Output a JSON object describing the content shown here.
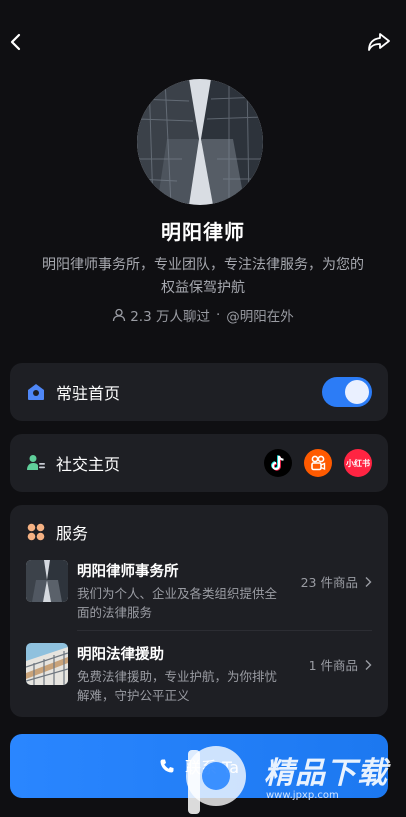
{
  "profile": {
    "name": "明阳律师",
    "description": "明阳律师事务所，专业团队，专注法律服务，为您的权益保驾护航",
    "chat_count": "2.3 万人聊过",
    "separator": "·",
    "handle": "@明阳在外"
  },
  "pin_home": {
    "label": "常驻首页",
    "enabled": true
  },
  "social": {
    "label": "社交主页",
    "platforms": [
      "douyin-icon",
      "kuaishou-icon",
      "xiaohongshu-icon"
    ],
    "xhs_text": "小红书"
  },
  "services": {
    "title": "服务",
    "items": [
      {
        "title": "明阳律师事务所",
        "text": "我们为个人、企业及各类组织提供全面的法律服务",
        "count": "23 件商品"
      },
      {
        "title": "明阳法律援助",
        "text": "免费法律援助，专业护航，为你排忧解难，守护公平正义",
        "count": "1 件商品"
      }
    ]
  },
  "contact": {
    "label": "联系 Ta"
  },
  "watermark": {
    "text": "精品下载",
    "url": "www.jpxp.com"
  },
  "colors": {
    "accent": "#2c7cf6",
    "background": "#0f0f12",
    "card": "#1e1f24"
  }
}
